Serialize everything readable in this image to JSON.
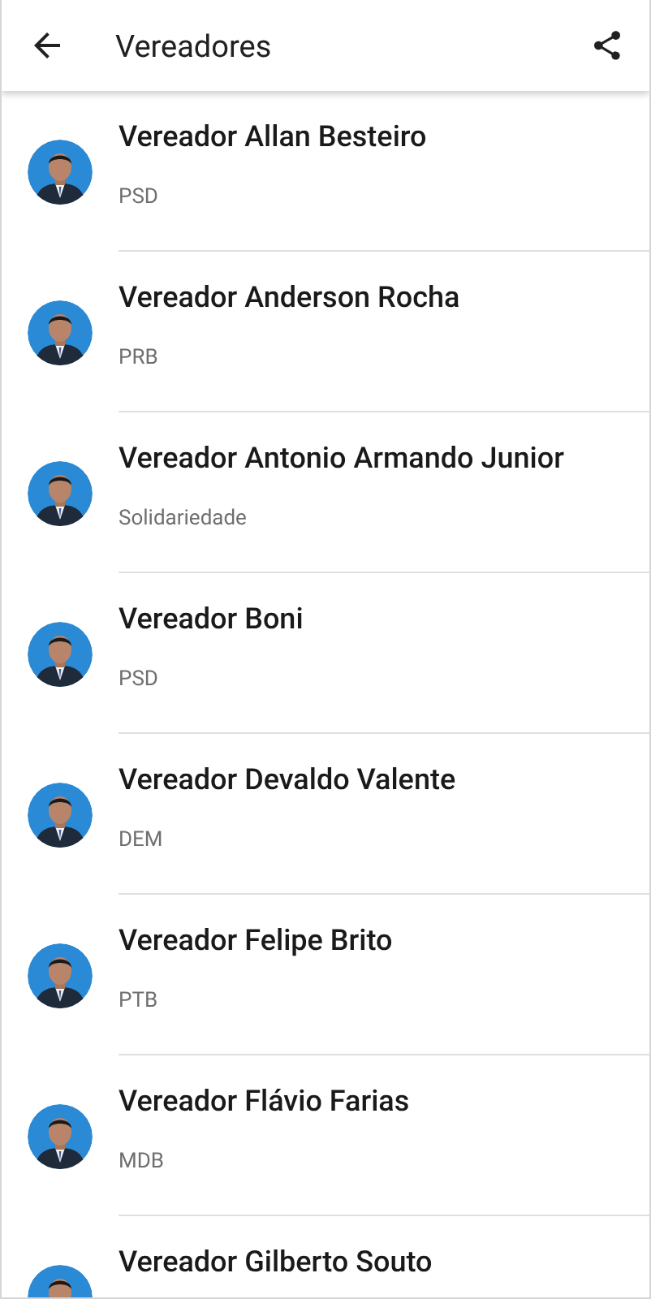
{
  "app_bar": {
    "title": "Vereadores"
  },
  "councillors": [
    {
      "name": "Vereador Allan Besteiro",
      "party": "PSD"
    },
    {
      "name": "Vereador Anderson Rocha",
      "party": "PRB"
    },
    {
      "name": "Vereador Antonio Armando Junior",
      "party": "Solidariedade"
    },
    {
      "name": "Vereador Boni",
      "party": "PSD"
    },
    {
      "name": "Vereador Devaldo Valente",
      "party": "DEM"
    },
    {
      "name": "Vereador Felipe Brito",
      "party": "PTB"
    },
    {
      "name": "Vereador Flávio Farias",
      "party": "MDB"
    },
    {
      "name": "Vereador Gilberto Souto"
    }
  ]
}
